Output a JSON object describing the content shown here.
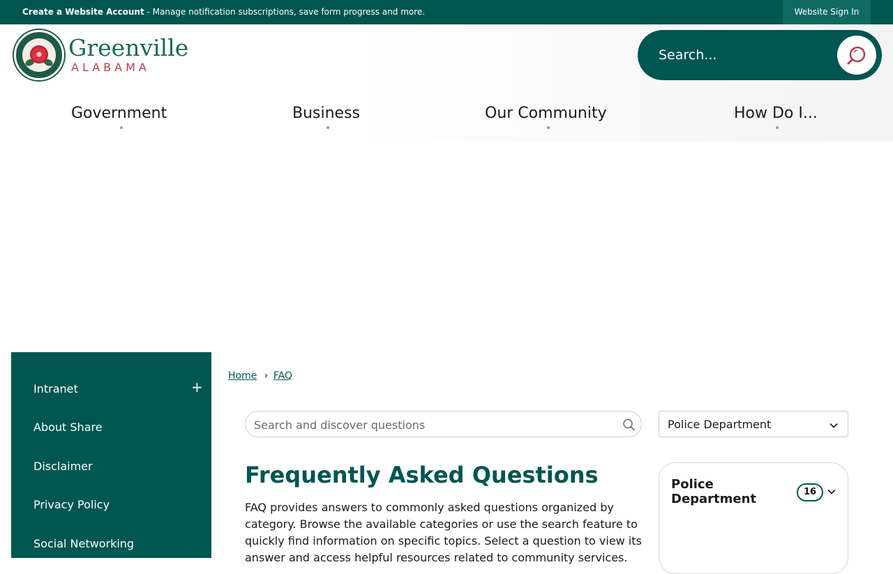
{
  "topbar": {
    "create_account": "Create a Website Account",
    "create_account_desc": " - Manage notification subscriptions, save form progress and more.",
    "sign_in": "Website Sign In"
  },
  "header": {
    "logo_name": "Greenville",
    "logo_state": "ALABAMA",
    "search_placeholder": "Search..."
  },
  "nav": {
    "items": [
      {
        "label": "Government"
      },
      {
        "label": "Business"
      },
      {
        "label": "Our Community"
      },
      {
        "label": "How Do I..."
      }
    ]
  },
  "sidebar": {
    "items": [
      {
        "label": "Intranet"
      },
      {
        "label": "About Share"
      },
      {
        "label": "Disclaimer"
      },
      {
        "label": "Privacy Policy"
      },
      {
        "label": "Social Networking"
      }
    ],
    "expand_label": "+"
  },
  "breadcrumb": {
    "home": "Home",
    "separator": "›",
    "current": "FAQ"
  },
  "faq": {
    "search_placeholder": "Search and discover questions",
    "category_select": "Police Department",
    "title": "Frequently Asked Questions",
    "description": "FAQ provides answers to commonly asked questions organized by category. Browse the available categories or use the search feature to quickly find information on specific topics. Select a question to view its answer and access helpful resources related to community services."
  },
  "category_card": {
    "name": "Police Department",
    "count": "16"
  },
  "colors": {
    "brand_teal": "#005650",
    "accent_red": "#b8404a"
  }
}
